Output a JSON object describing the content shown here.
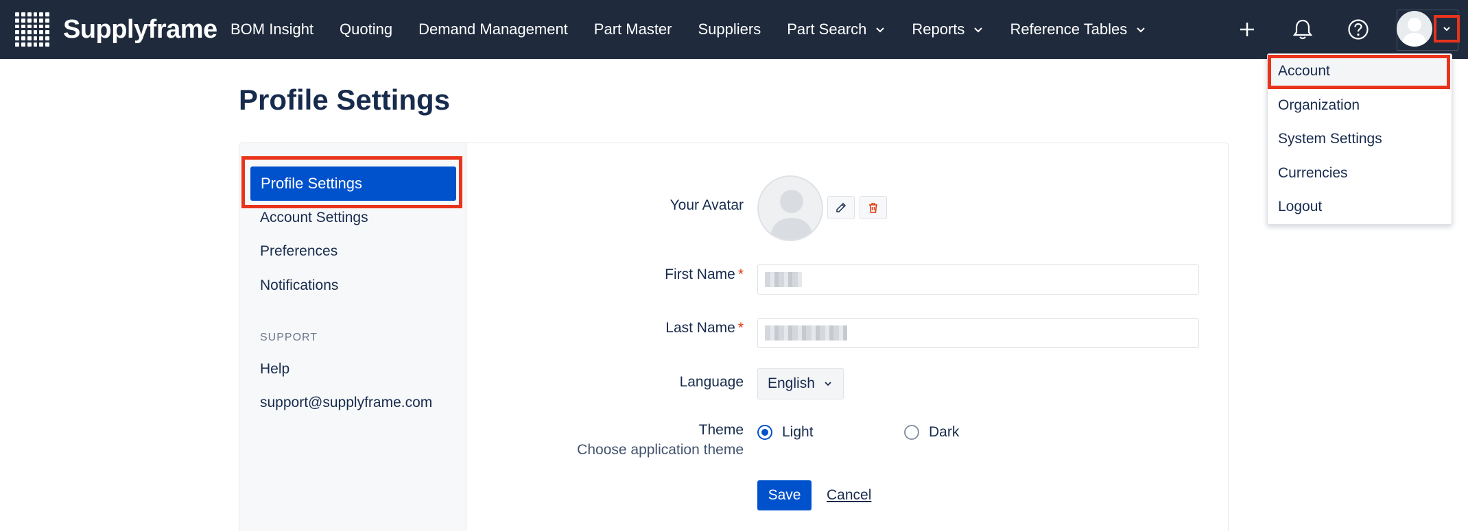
{
  "app": {
    "brand": "Supplyframe"
  },
  "nav": {
    "items": [
      {
        "label": "BOM Insight",
        "has_dropdown": false
      },
      {
        "label": "Quoting",
        "has_dropdown": false
      },
      {
        "label": "Demand Management",
        "has_dropdown": false
      },
      {
        "label": "Part Master",
        "has_dropdown": false
      },
      {
        "label": "Suppliers",
        "has_dropdown": false
      },
      {
        "label": "Part Search",
        "has_dropdown": true
      },
      {
        "label": "Reports",
        "has_dropdown": true
      },
      {
        "label": "Reference Tables",
        "has_dropdown": true
      }
    ],
    "icons": [
      "plus-icon",
      "bell-icon",
      "help-icon",
      "user-avatar",
      "chevron-down-icon"
    ]
  },
  "user_menu": {
    "items": [
      "Account",
      "Organization",
      "System Settings",
      "Currencies",
      "Logout"
    ],
    "highlighted": "Account"
  },
  "page": {
    "title": "Profile Settings"
  },
  "sidebar": {
    "items": [
      "Profile Settings",
      "Account Settings",
      "Preferences",
      "Notifications"
    ],
    "active": "Profile Settings",
    "support_heading": "SUPPORT",
    "support_items": [
      "Help",
      "support@supplyframe.com"
    ]
  },
  "form": {
    "avatar_label": "Your Avatar",
    "first_name_label": "First Name",
    "last_name_label": "Last Name",
    "required_mark": "*",
    "language_label": "Language",
    "language_value": "English",
    "theme_label": "Theme",
    "theme_sublabel": "Choose application theme",
    "theme_options": [
      "Light",
      "Dark"
    ],
    "theme_selected": "Light",
    "save_label": "Save",
    "cancel_label": "Cancel"
  },
  "colors": {
    "topbar": "#1f2b3d",
    "primary": "#0052cc",
    "highlight_box": "#e8341c",
    "required": "#de350b"
  }
}
